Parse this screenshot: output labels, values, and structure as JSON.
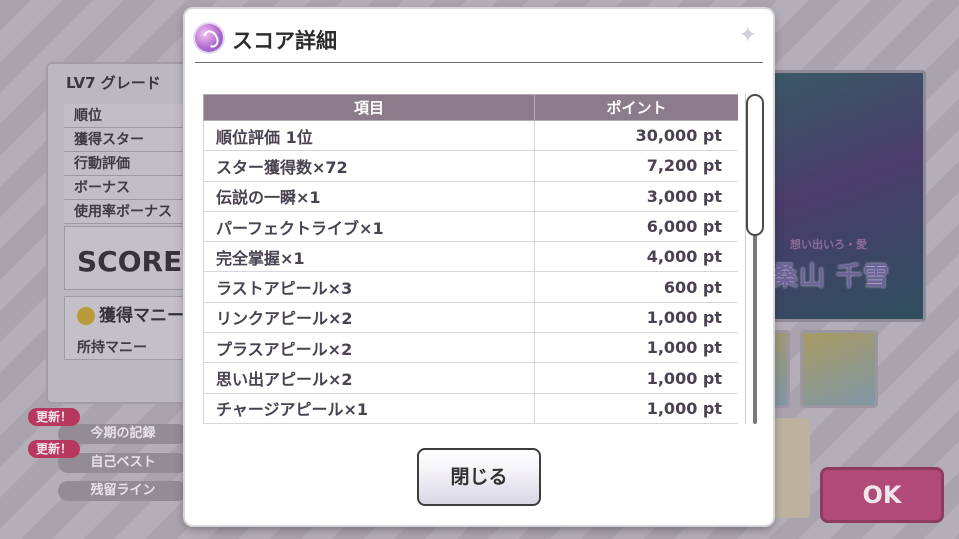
{
  "background": {
    "panel_title": "LV7 グレード",
    "rows": [
      "順位",
      "獲得スター",
      "行動評価",
      "ボーナス",
      "使用率ボーナス"
    ],
    "score_label": "SCORE",
    "money_title": "獲得マニー",
    "money_label": "所持マニー",
    "records": [
      {
        "new_badge": "更新！",
        "label": "今期の記録"
      },
      {
        "new_badge": "更新！",
        "label": "自己ベスト"
      },
      {
        "new_badge": "",
        "label": "残留ライン"
      }
    ],
    "card_name": "桑山 千雪",
    "card_subtitle": "想い出いろ・愛",
    "ok_label": "OK"
  },
  "modal": {
    "title": "スコア詳細",
    "columns": [
      "項目",
      "ポイント"
    ],
    "rows": [
      {
        "item": "順位評価 1位",
        "points": "30,000 pt"
      },
      {
        "item": "スター獲得数×72",
        "points": "7,200 pt"
      },
      {
        "item": "伝説の一瞬×1",
        "points": "3,000 pt"
      },
      {
        "item": "パーフェクトライブ×1",
        "points": "6,000 pt"
      },
      {
        "item": "完全掌握×1",
        "points": "4,000 pt"
      },
      {
        "item": "ラストアピール×3",
        "points": "600 pt"
      },
      {
        "item": "リンクアピール×2",
        "points": "1,000 pt"
      },
      {
        "item": "プラスアピール×2",
        "points": "1,000 pt"
      },
      {
        "item": "思い出アピール×2",
        "points": "1,000 pt"
      },
      {
        "item": "チャージアピール×1",
        "points": "1,000 pt"
      }
    ],
    "close_label": "閉じる"
  }
}
